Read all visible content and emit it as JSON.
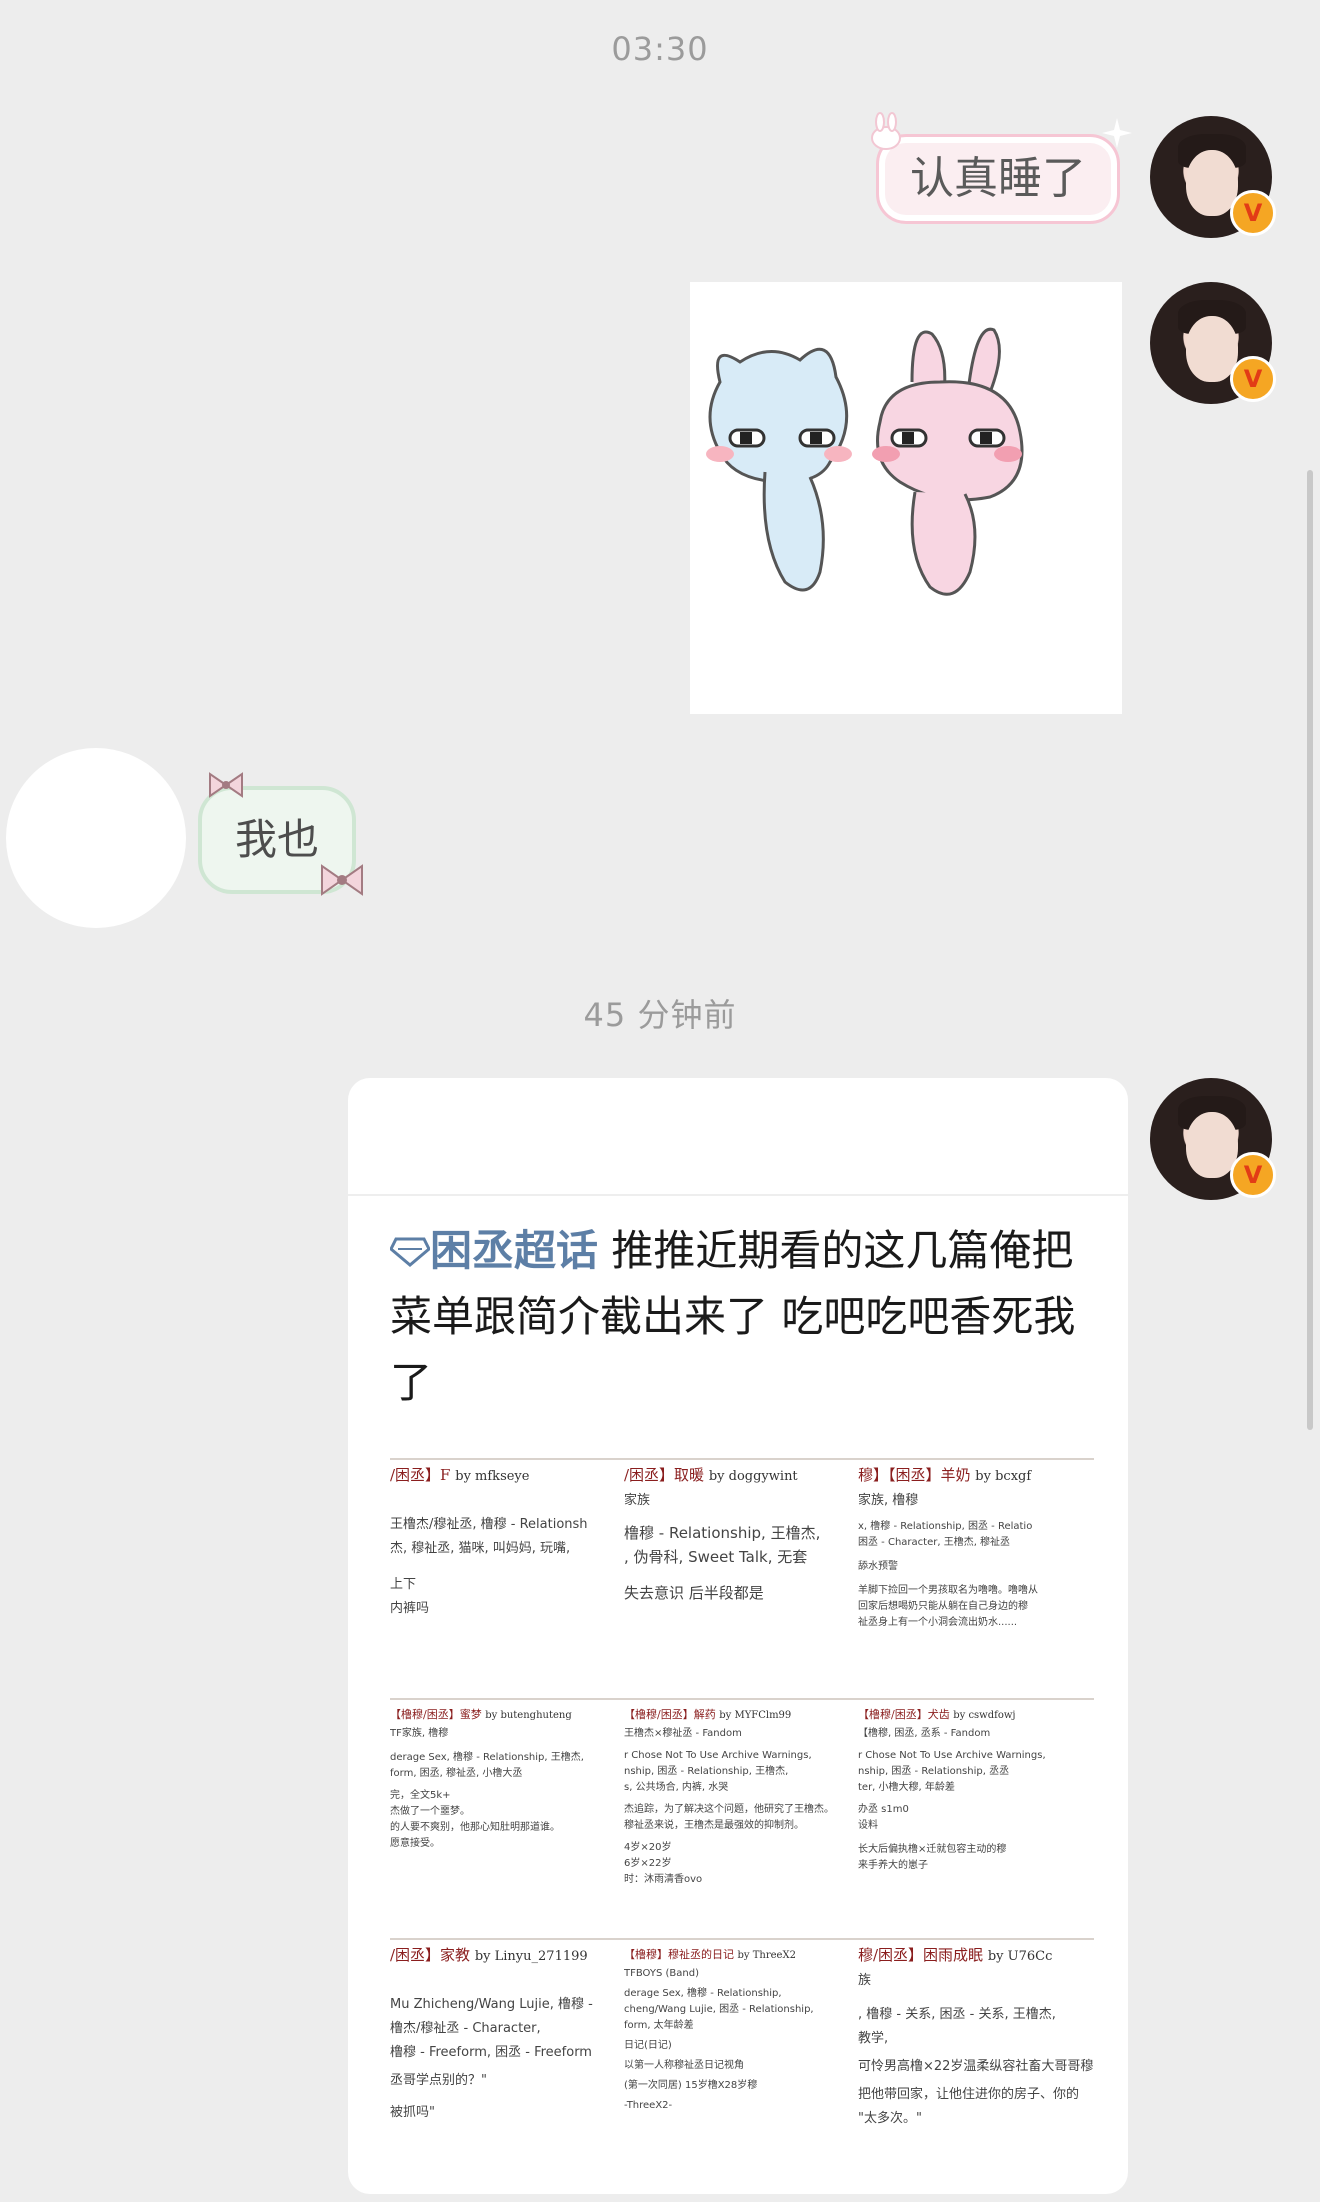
{
  "chat": {
    "timestamp_top": "03:30",
    "timestamp_mid": "45 分钟前",
    "msg_self_text": "认真睡了",
    "msg_other_text": "我也",
    "verified_badge": "V",
    "sticker_icon": "cat-bunny-sticker-icon"
  },
  "card": {
    "topic": "困丞超话",
    "headline_rest": " 推推近期看的这几篇俺把菜单跟简介截出来了 吃吧吃吧香死我了",
    "thumbs": [
      {
        "title": "/困丞】F",
        "by": "by mfkseye",
        "lines": [
          "王橹杰/穆祉丞, 橹穆 - Relationsh",
          "杰, 穆祉丞, 猫咪, 叫妈妈, 玩嘴,",
          "上下",
          "内裤吗"
        ]
      },
      {
        "title": "/困丞】取暖",
        "by": "by doggywint",
        "lines": [
          "家族",
          "橹穆 - Relationship, 王橹杰,",
          ", 伪骨科, Sweet Talk, 无套",
          "失去意识 后半段都是"
        ]
      },
      {
        "title": "穆】【困丞】羊奶",
        "by": "by bcxgf",
        "lines": [
          "家族, 橹穆",
          "x, 橹穆 - Relationship, 困丞 - Relatio",
          "困丞 - Character, 王橹杰, 穆祉丞",
          "舔水预警",
          "羊脚下捡回一个男孩取名为噜噜。噜噜从",
          "回家后想喝奶只能从躺在自己身边的穆",
          "祉丞身上有一个小洞会流出奶水......"
        ]
      },
      {
        "title": "【橹穆/困丞】蜜梦",
        "by": "by butenghuteng",
        "lines": [
          "TF家族, 橹穆",
          "derage Sex, 橹穆 - Relationship, 王橹杰,",
          "form, 困丞, 穆祉丞, 小橹大丞",
          "完，全文5k+",
          "杰做了一个噩梦。",
          "的人要不爽别，他那心知肚明那道谁。",
          "愿意接受。"
        ]
      },
      {
        "title": "【橹穆/困丞】解药",
        "by": "by MYFClm99",
        "lines": [
          "王橹杰×穆祉丞 - Fandom",
          "r Chose Not To Use Archive Warnings,",
          "nship, 困丞 - Relationship, 王橹杰,",
          "s, 公共场合, 内裤, 水哭",
          "杰追踪，为了解决这个问题，他研究了王橹杰。",
          "穆祉丞来说，王橹杰是最强效的抑制剂。",
          "4岁×20岁",
          "6岁×22岁",
          "时：沐雨清香ovo"
        ]
      },
      {
        "title": "【橹穆/困丞】犬齿",
        "by": "by cswdfowj",
        "lines": [
          "【橹穆, 困丞, 丞系 - Fandom",
          "r Chose Not To Use Archive Warnings,",
          "nship, 困丞 - Relationship, 丞丞",
          "ter, 小橹大穆, 年龄差",
          "办丞 s1m0",
          "设料",
          "长大后偏执橹×迁就包容主动的穆",
          "来手养大的崽子"
        ]
      },
      {
        "title": "/困丞】家教",
        "by": "by Linyu_271199",
        "lines": [
          "Mu Zhicheng/Wang Lujie, 橹穆 -",
          "橹杰/穆祉丞 - Character,",
          "橹穆 - Freeform, 困丞 - Freeform",
          "丞哥学点别的？\"",
          "被抓吗\""
        ]
      },
      {
        "title": "【橹穆】穆祉丞的日记",
        "by": "by ThreeX2",
        "lines": [
          "TFBOYS (Band)",
          "derage Sex, 橹穆 - Relationship,",
          "cheng/Wang Lujie, 困丞 - Relationship,",
          "form, 太年龄差",
          "日记(日记)",
          "以第一人称穆祉丞日记视角",
          "(第一次同居) 15岁橹X28岁穆",
          "-ThreeX2-"
        ]
      },
      {
        "title": "穆/困丞】困雨成眠",
        "by": "by U76Cc",
        "lines": [
          "族",
          ", 橹穆 - 关系, 困丞 - 关系, 王橹杰,",
          "教学,",
          "可怜男高橹×22岁温柔纵容社畜大哥哥穆",
          "把他带回家，让他住进你的房子、你的",
          "\"太多次。\""
        ]
      }
    ]
  },
  "colors": {
    "background": "#ededed",
    "self_bubble_bg": "#fbeef1",
    "other_bubble_bg": "#eef6ef",
    "topic": "#5d7fa6",
    "ao3_title": "#8a1e1e",
    "badge": "#f5a623"
  }
}
